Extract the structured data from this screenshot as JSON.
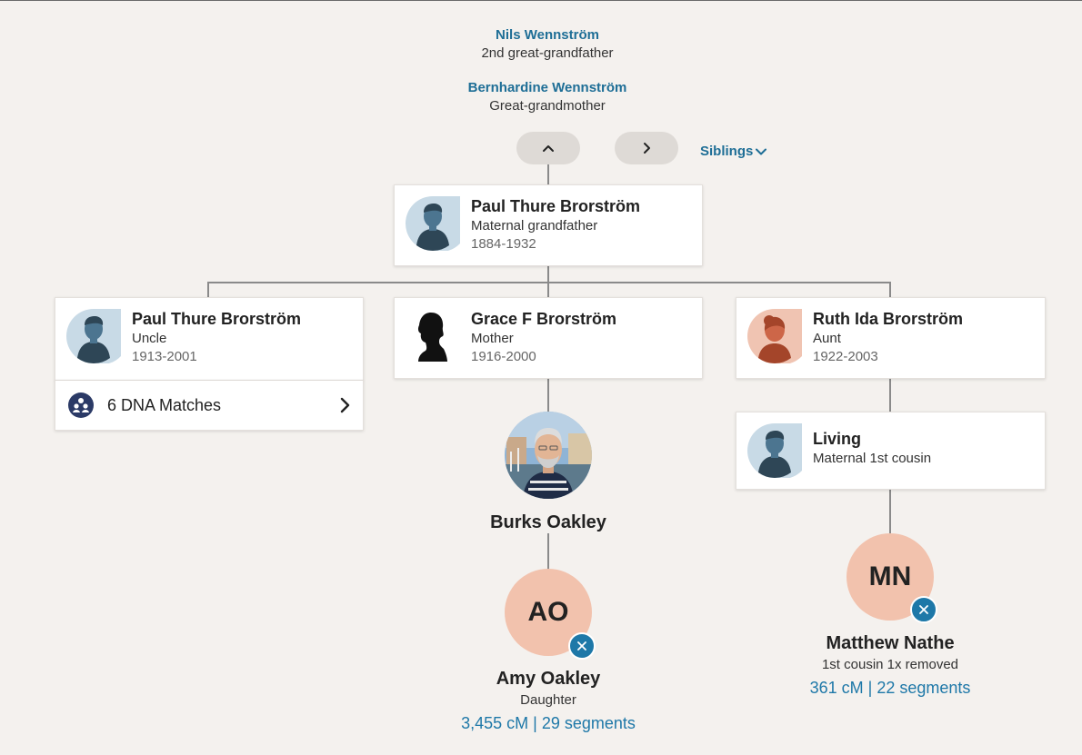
{
  "ancestors": [
    {
      "name": "Nils Wennström",
      "relation": "2nd great-grandfather"
    },
    {
      "name": "Bernhardine Wennström",
      "relation": "Great-grandmother"
    }
  ],
  "nav": {
    "up_icon": "chevron-up-icon",
    "next_icon": "chevron-right-icon",
    "siblings_label": "Siblings"
  },
  "grandfather": {
    "name": "Paul Thure Brorström",
    "relation": "Maternal grandfather",
    "years": "1884-1932"
  },
  "children": [
    {
      "name": "Paul Thure Brorström",
      "relation": "Uncle",
      "years": "1913-2001",
      "avatar": "male-silhouette-icon"
    },
    {
      "name": "Grace F Brorström",
      "relation": "Mother",
      "years": "1916-2000",
      "avatar": "female-profile-silhouette-icon"
    },
    {
      "name": "Ruth Ida Brorström",
      "relation": "Aunt",
      "years": "1922-2003",
      "avatar": "female-silhouette-icon"
    }
  ],
  "dna_matches": {
    "label": "6 DNA Matches"
  },
  "cousin": {
    "name": "Living",
    "relation": "Maternal 1st cousin"
  },
  "self": {
    "name": "Burks Oakley"
  },
  "daughter": {
    "initials": "AO",
    "name": "Amy Oakley",
    "relation": "Daughter",
    "dna": "3,455 cM | 29 segments"
  },
  "cousin_match": {
    "initials": "MN",
    "name": "Matthew Nathe",
    "relation": "1st cousin 1x removed",
    "dna": "361 cM | 22 segments"
  },
  "colors": {
    "accent": "#1e6e96",
    "match_circle": "#f2c2ad",
    "dna_badge": "#1e78a8",
    "background": "#f4f1ee"
  }
}
